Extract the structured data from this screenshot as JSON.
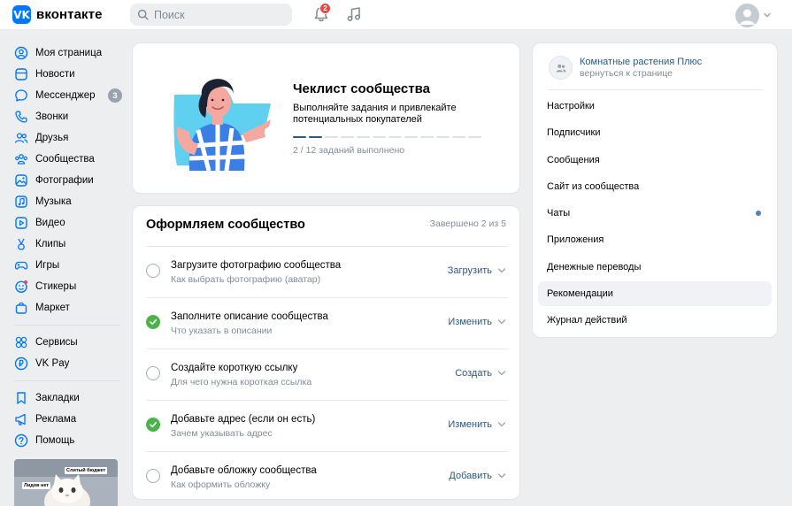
{
  "header": {
    "logo_mark": "VK",
    "logo_text": "вконтакте",
    "search_placeholder": "Поиск",
    "notifications_count": "2"
  },
  "nav": {
    "items": [
      {
        "label": "Моя страница",
        "icon": "user-circle-icon"
      },
      {
        "label": "Новости",
        "icon": "news-icon"
      },
      {
        "label": "Мессенджер",
        "icon": "message-icon",
        "badge": "3"
      },
      {
        "label": "Звонки",
        "icon": "phone-icon"
      },
      {
        "label": "Друзья",
        "icon": "friends-icon"
      },
      {
        "label": "Сообщества",
        "icon": "communities-icon"
      },
      {
        "label": "Фотографии",
        "icon": "photo-icon"
      },
      {
        "label": "Музыка",
        "icon": "music-icon"
      },
      {
        "label": "Видео",
        "icon": "video-icon"
      },
      {
        "label": "Клипы",
        "icon": "clips-icon"
      },
      {
        "label": "Игры",
        "icon": "gamepad-icon"
      },
      {
        "label": "Стикеры",
        "icon": "sticker-icon"
      },
      {
        "label": "Маркет",
        "icon": "market-bag-icon"
      }
    ],
    "items2": [
      {
        "label": "Сервисы",
        "icon": "services-icon"
      },
      {
        "label": "VK Pay",
        "icon": "vkpay-icon"
      }
    ],
    "items3": [
      {
        "label": "Закладки",
        "icon": "bookmark-icon"
      },
      {
        "label": "Реклама",
        "icon": "megaphone-icon"
      },
      {
        "label": "Помощь",
        "icon": "help-icon"
      }
    ],
    "promo_labels": [
      "Слитый бюджет",
      "Лидов нет"
    ]
  },
  "checklist": {
    "title": "Чеклист сообщества",
    "description": "Выполняйте задания и привлекайте потенциальных покупателей",
    "done": 2,
    "total": 12,
    "count_text": "2 / 12 заданий выполнено",
    "colors": {
      "done": "#2a5885",
      "todo": "#dce1e6"
    }
  },
  "setup": {
    "title": "Оформляем сообщество",
    "status": "Завершено 2 из 5",
    "tasks": [
      {
        "title": "Загрузите фотографию сообщества",
        "subtitle": "Как выбрать фотографию (аватар)",
        "action": "Загрузить",
        "done": false
      },
      {
        "title": "Заполните описание сообщества",
        "subtitle": "Что указать в описании",
        "action": "Изменить",
        "done": true
      },
      {
        "title": "Создайте короткую ссылку",
        "subtitle": "Для чего нужна короткая ссылка",
        "action": "Создать",
        "done": false
      },
      {
        "title": "Добавьте адрес (если он есть)",
        "subtitle": "Зачем указывать адрес",
        "action": "Изменить",
        "done": true
      },
      {
        "title": "Добавьте обложку сообщества",
        "subtitle": "Как оформить обложку",
        "action": "Добавить",
        "done": false
      }
    ]
  },
  "community": {
    "name": "Комнатные растения Плюс",
    "back": "вернуться к странице",
    "menu": [
      {
        "label": "Настройки"
      },
      {
        "label": "Подписчики"
      },
      {
        "label": "Сообщения"
      },
      {
        "label": "Сайт из сообщества"
      },
      {
        "label": "Чаты",
        "dot": true
      },
      {
        "label": "Приложения"
      },
      {
        "label": "Денежные переводы"
      },
      {
        "label": "Рекомендации",
        "active": true
      },
      {
        "label": "Журнал действий"
      }
    ]
  }
}
